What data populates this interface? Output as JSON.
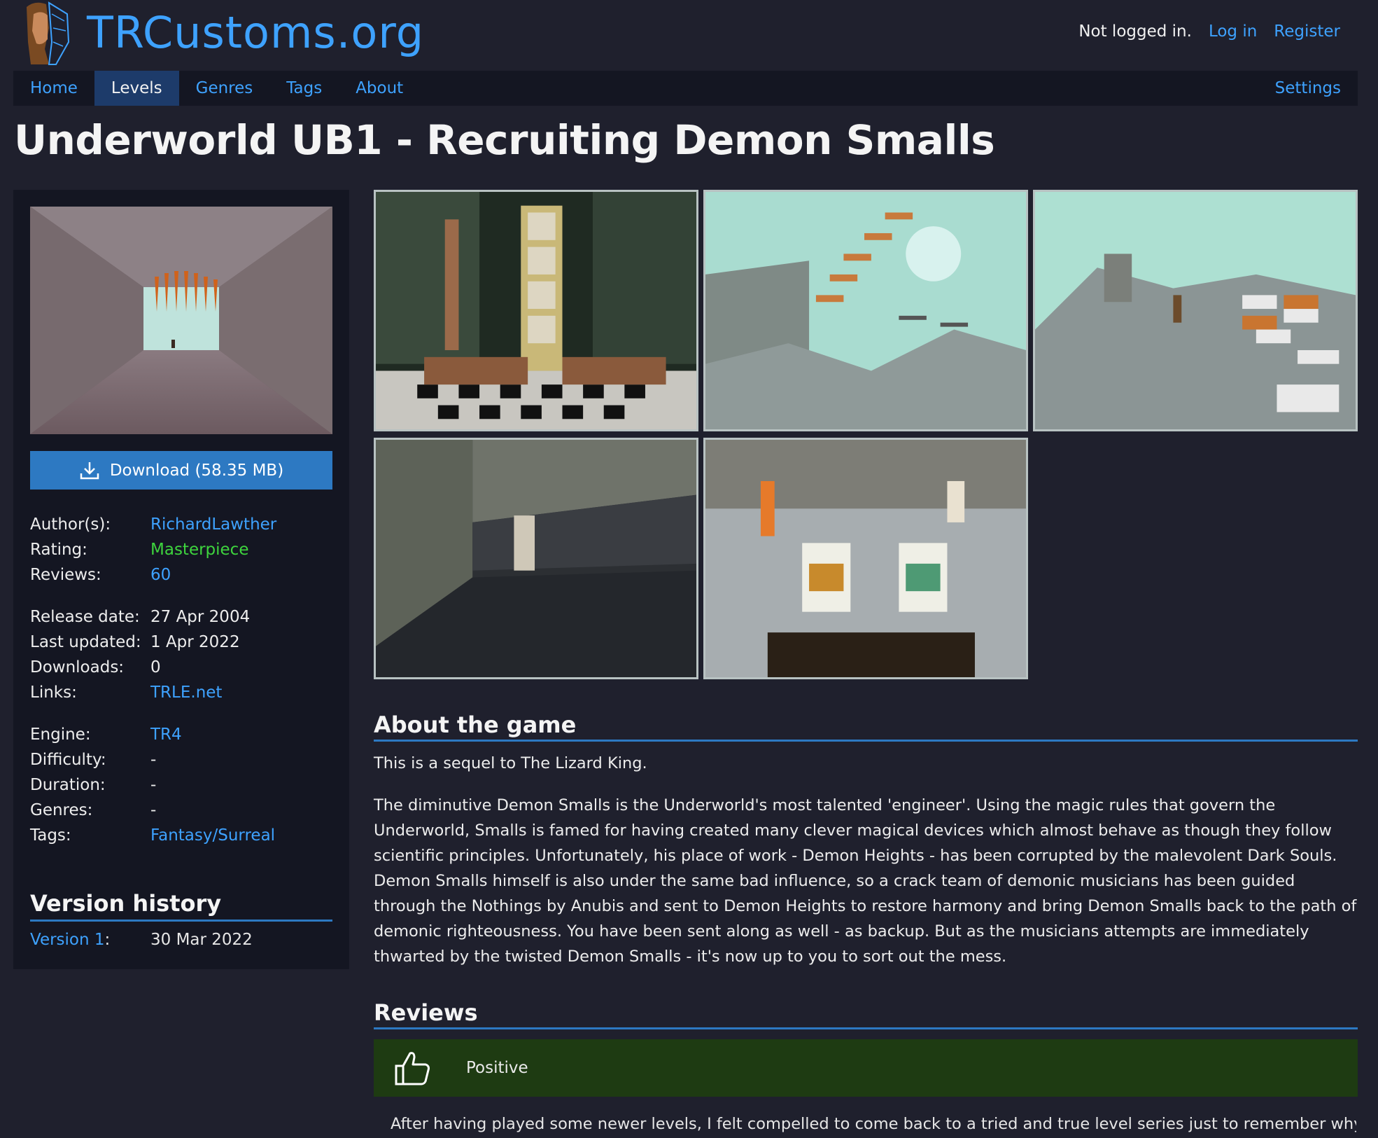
{
  "header": {
    "site_name": "TRCustoms.org",
    "auth_status": "Not logged in.",
    "login_label": "Log in",
    "register_label": "Register"
  },
  "nav": {
    "items": [
      {
        "label": "Home"
      },
      {
        "label": "Levels"
      },
      {
        "label": "Genres"
      },
      {
        "label": "Tags"
      },
      {
        "label": "About"
      }
    ],
    "active": "Levels",
    "settings_label": "Settings"
  },
  "level": {
    "title": "Underworld UB1 - Recruiting Demon Smalls",
    "download_label": "Download (58.35 MB)"
  },
  "info": {
    "authors": {
      "label": "Author(s):",
      "value": "RichardLawther"
    },
    "rating": {
      "label": "Rating:",
      "value": "Masterpiece"
    },
    "reviews": {
      "label": "Reviews:",
      "value": "60"
    },
    "release_date": {
      "label": "Release date:",
      "value": "27 Apr 2004"
    },
    "last_updated": {
      "label": "Last updated:",
      "value": "1 Apr 2022"
    },
    "downloads": {
      "label": "Downloads:",
      "value": "0"
    },
    "links": {
      "label": "Links:",
      "value": "TRLE.net"
    },
    "engine": {
      "label": "Engine:",
      "value": "TR4"
    },
    "difficulty": {
      "label": "Difficulty:",
      "value": "-"
    },
    "duration": {
      "label": "Duration:",
      "value": "-"
    },
    "genres": {
      "label": "Genres:",
      "value": "-"
    },
    "tags": {
      "label": "Tags:",
      "value": "Fantasy/Surreal"
    }
  },
  "version_history": {
    "title": "Version history",
    "versions": [
      {
        "label": "Version 1",
        "colon": ":",
        "date": "30 Mar 2022"
      }
    ]
  },
  "about": {
    "title": "About the game",
    "paragraphs": [
      "This is a sequel to The Lizard King.",
      "The diminutive Demon Smalls is the Underworld's most talented 'engineer'. Using the magic rules that govern the Underworld, Smalls is famed for having created many clever magical devices which almost behave as though they follow scientific principles. Unfortunately, his place of work - Demon Heights - has been corrupted by the malevolent Dark Souls. Demon Smalls himself is also under the same bad influence, so a crack team of demonic musicians has been guided through the Nothings by Anubis and sent to Demon Heights to restore harmony and bring Demon Smalls back to the path of demonic righteousness. You have been sent along as well - as backup. But as the musicians attempts are immediately thwarted by the twisted Demon Smalls - it's now up to you to sort out the mess."
    ]
  },
  "reviews": {
    "title": "Reviews",
    "first": {
      "verdict": "Positive",
      "text": "After having played some newer levels, I felt compelled to come back to a tried and true level series just to remember why I"
    }
  },
  "colors": {
    "background": "#1f202d",
    "panel": "#141622",
    "accent": "#3ea2ff",
    "button": "#2d79c2",
    "rating": "#3ed43e",
    "positive_review": "#1e3b12"
  }
}
